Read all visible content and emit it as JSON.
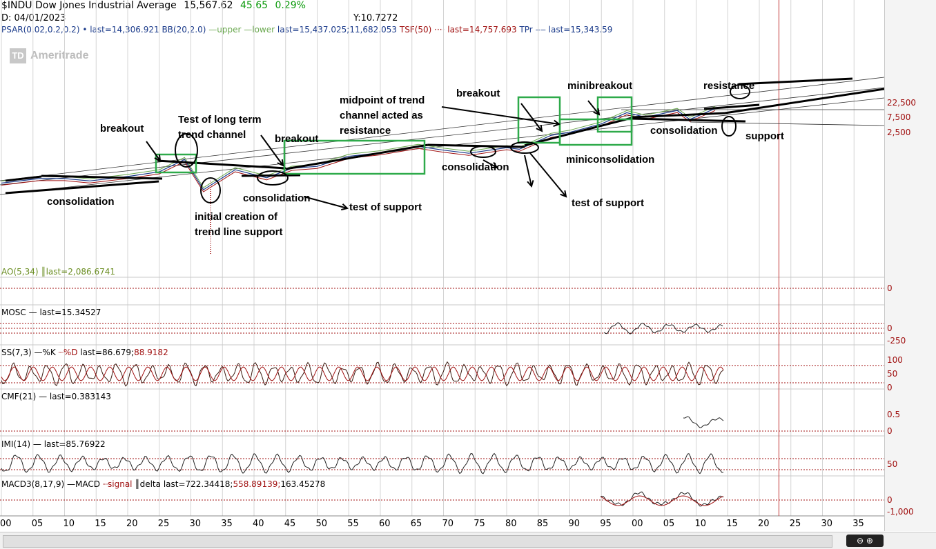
{
  "header": {
    "symbol": "$INDU",
    "name": "Dow Jones Industrial Average",
    "last": "15,567.62",
    "change": "45.65",
    "change_pct": "0.29%",
    "date": "D: 04/01/2023",
    "y_readout": "Y:10.7272",
    "studies": [
      {
        "label": "PSAR(0.02,0.2,0.2)",
        "color": "#1a3a8a"
      },
      {
        "label": "• last=14,306.921",
        "color": "#1a3a8a"
      },
      {
        "label": "BB(20,2.0)",
        "color": "#1a3a8a"
      },
      {
        "label": "—upper",
        "color": "#6aa84f"
      },
      {
        "label": "—lower",
        "color": "#6aa84f"
      },
      {
        "label": "last=15,437.025;11,682.053",
        "color": "#1a3a8a"
      },
      {
        "label": "TSF(50)",
        "color": "#a01010"
      },
      {
        "label": "···· last=14,757.693",
        "color": "#a01010"
      },
      {
        "label": "TPr",
        "color": "#1a3a8a"
      },
      {
        "label": "‒‒ last=15,343.59",
        "color": "#1a3a8a"
      }
    ]
  },
  "logo": {
    "badge": "TD",
    "text": "Ameritrade"
  },
  "colors": {
    "accent_green": "#0a9a0a",
    "price_red": "#a01010",
    "box_green": "#2eaa4a",
    "grid": "#d0d0d0"
  },
  "chart_data": [
    {
      "type": "line",
      "panel": "price",
      "title": "$INDU Dow Jones Industrial Average",
      "scale": "log",
      "y_ticks": [
        "22,500",
        "7,500",
        "2,500"
      ],
      "y_tick_values": [
        22500,
        7500,
        2500
      ],
      "x": [
        1900,
        1906,
        1910,
        1914,
        1920,
        1925,
        1929,
        1932,
        1937,
        1942,
        1946,
        1950,
        1955,
        1960,
        1966,
        1970,
        1974,
        1980,
        1982,
        1987,
        1990,
        1995,
        1999,
        2002,
        2007,
        2009,
        2013
      ],
      "values": [
        68,
        95,
        95,
        80,
        110,
        155,
        380,
        42,
        180,
        100,
        200,
        230,
        480,
        620,
        990,
        750,
        600,
        900,
        800,
        2200,
        2750,
        5100,
        11500,
        8300,
        13500,
        7000,
        15567
      ],
      "x_tick_labels": [
        "00",
        "05",
        "10",
        "15",
        "20",
        "25",
        "30",
        "35",
        "40",
        "45",
        "50",
        "55",
        "60",
        "65",
        "70",
        "75",
        "80",
        "85",
        "90",
        "95",
        "00",
        "05",
        "10",
        "15",
        "20",
        "25",
        "30",
        "35"
      ],
      "x_tick_years": [
        1900,
        1905,
        1910,
        1915,
        1920,
        1925,
        1930,
        1935,
        1940,
        1945,
        1950,
        1955,
        1960,
        1965,
        1970,
        1975,
        1980,
        1985,
        1990,
        1995,
        2000,
        2005,
        2010,
        2015,
        2020,
        2025,
        2030,
        2035
      ],
      "cursor_year": 2023,
      "annotations": [
        "breakout",
        "Test of long term trend channel",
        "breakout",
        "midpoint of trend channel acted as resistance",
        "breakout",
        "minibreakout",
        "resistance",
        "consolidation",
        "initial creation of trend line support",
        "consolidation",
        "test of support",
        "consolidation",
        "miniconsolidation",
        "test of support",
        "consolidation",
        "support"
      ]
    },
    {
      "type": "bar",
      "panel": "AO",
      "label": "AO(5,34)",
      "legend": "last=2,086.6741",
      "color": "#6b8e23",
      "y_ticks": [
        "0"
      ]
    },
    {
      "type": "line",
      "panel": "MOSC",
      "label": "MOSC",
      "legend": "last=15.34527",
      "y_ticks": [
        "0",
        "-250"
      ],
      "x_start": 1994
    },
    {
      "type": "line",
      "panel": "SS",
      "label": "SS(7,3)",
      "legend_k": "%K",
      "legend_d": "%D",
      "legend_last": "last=86.679;",
      "legend_last2": "88.9182",
      "y_ticks": [
        "100",
        "50",
        "0"
      ]
    },
    {
      "type": "line",
      "panel": "CMF",
      "label": "CMF(21)",
      "legend": "last=0.383143",
      "y_ticks": [
        "0.5",
        "0"
      ],
      "x_start": 2007
    },
    {
      "type": "line",
      "panel": "IMI",
      "label": "IMI(14)",
      "legend": "last=85.76922",
      "y_ticks": [
        "50"
      ]
    },
    {
      "type": "line",
      "panel": "MACD",
      "label": "MACD3(8,17,9)",
      "legend_macd": "MACD",
      "legend_signal": "signal",
      "legend_delta": "delta",
      "legend_last": "last=722.34418;",
      "legend_last2": "558.89139;",
      "legend_last3": "163.45278",
      "y_ticks": [
        "0",
        "-1,000"
      ]
    }
  ],
  "scrollbar": {
    "zoom_label": "⊖ ⊕"
  }
}
